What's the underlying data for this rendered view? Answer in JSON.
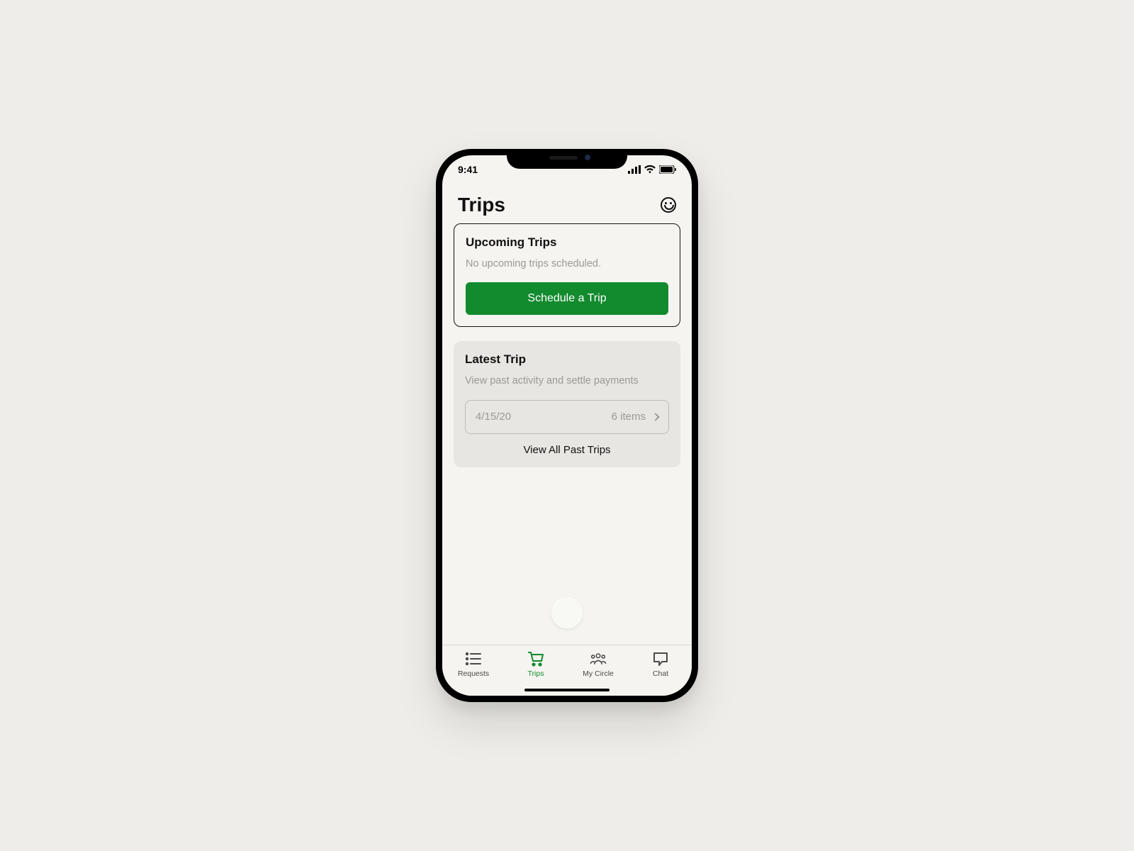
{
  "status": {
    "time": "9:41"
  },
  "header": {
    "title": "Trips"
  },
  "upcoming": {
    "title": "Upcoming Trips",
    "empty_text": "No upcoming trips scheduled.",
    "cta": "Schedule a Trip"
  },
  "latest": {
    "title": "Latest Trip",
    "subtitle": "View past activity and settle payments",
    "row": {
      "date": "4/15/20",
      "items": "6 items"
    },
    "view_all": "View All Past Trips"
  },
  "tabs": {
    "requests": "Requests",
    "trips": "Trips",
    "mycircle": "My Circle",
    "chat": "Chat"
  },
  "colors": {
    "accent": "#128a2e"
  }
}
